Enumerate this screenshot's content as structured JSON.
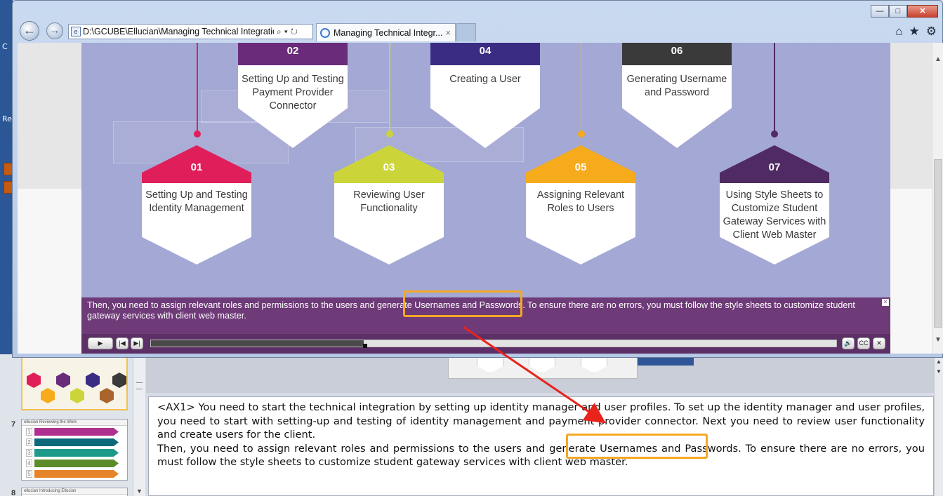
{
  "desktop": {
    "label_c": "C",
    "label_re": "Re"
  },
  "browser": {
    "address": "D:\\GCUBE\\Ellucian\\Managing Technical Integration",
    "tab_title": "Managing Technical Integr...",
    "tab_close": "×",
    "back_glyph": "←",
    "forward_glyph": "→",
    "window_controls": {
      "minimize": "—",
      "maximize": "□",
      "close": "✕"
    },
    "toolbar_icons": [
      "home-icon",
      "star-icon",
      "gear-icon"
    ]
  },
  "slide": {
    "steps": [
      {
        "num": "01",
        "label": "Setting Up and Testing Identity Management",
        "color": "#e01f5a",
        "row": "bottom"
      },
      {
        "num": "02",
        "label": "Setting Up and Testing Payment Provider Connector",
        "color": "#6a2c7a",
        "row": "top"
      },
      {
        "num": "03",
        "label": "Reviewing User Functionality",
        "color": "#cbd53a",
        "row": "bottom"
      },
      {
        "num": "04",
        "label": "Creating a User",
        "color": "#3b2c83",
        "row": "top"
      },
      {
        "num": "05",
        "label": "Assigning Relevant Roles to Users",
        "color": "#f5ab1b",
        "row": "bottom"
      },
      {
        "num": "06",
        "label": "Generating Username and Password",
        "color": "#3a3a3a",
        "row": "top"
      },
      {
        "num": "07",
        "label": "Using Style Sheets to Customize Student Gateway Services with Client Web Master",
        "color": "#4f2a63",
        "row": "bottom"
      }
    ],
    "caption_before": "Then, you need to assign relevant roles and permissions to the users and generate ",
    "caption_highlight": "Usernames and Passwords.",
    "caption_after": " To ensure there are no errors, you must follow the style sheets to customize student gateway services with client web master.",
    "caption_close": "×"
  },
  "player": {
    "play": "▶",
    "prev": "|◀",
    "next": "▶|",
    "volume": "🔊",
    "cc": "CC",
    "close": "✕",
    "progress": 0.31
  },
  "thumbnails": {
    "slide7_num": "7",
    "slide8_num": "8",
    "slide7_head": "ellucian   Reviewing the Work",
    "slide8_head": "ellucian   Introducing Ellucian"
  },
  "notes": {
    "line1": "<AX1> You need to start the technical integration by setting up identity manager and user profiles. To set up the identity manager and user profiles, you need to start with setting-up and testing of identity management and payment provider connector. Next you need to review user functionality and create users for the client.",
    "line2_before": "Then, you need to assign relevant roles and permissions to the users and generate ",
    "line2_highlight": "Usernames and Passwords.",
    "line2_after": " To ensure there are no errors, you must follow the style sheets to customize student gateway services with client web master."
  },
  "colors": {
    "highlight": "#f4a825",
    "arrow": "#e8231c",
    "stage": "#a3a8d4",
    "caption_bg": "#6e3a78"
  }
}
